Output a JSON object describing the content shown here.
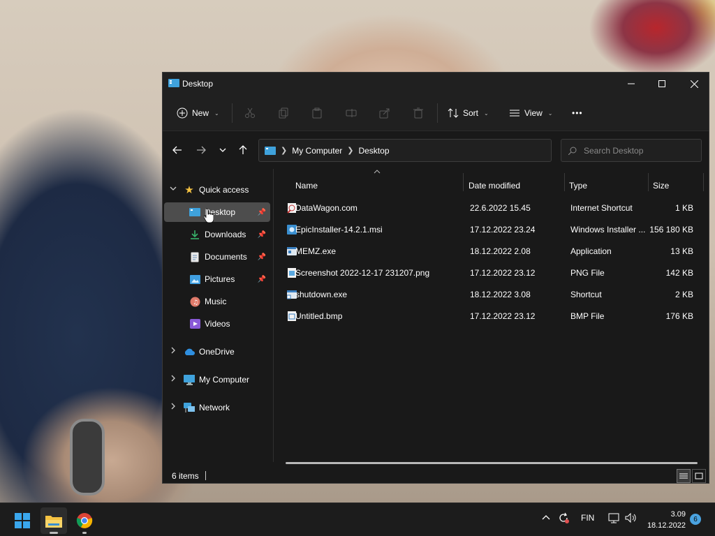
{
  "window": {
    "title": "Desktop"
  },
  "toolbar": {
    "new_label": "New",
    "sort_label": "Sort",
    "view_label": "View",
    "more_label": "•••"
  },
  "address": {
    "crumbs": [
      "My Computer",
      "Desktop"
    ],
    "search_placeholder": "Search Desktop"
  },
  "sidebar": {
    "quick_access": "Quick access",
    "items": [
      {
        "label": "Desktop",
        "icon": "desktop-icon",
        "pinned": true
      },
      {
        "label": "Downloads",
        "icon": "download-icon",
        "pinned": true
      },
      {
        "label": "Documents",
        "icon": "document-icon",
        "pinned": true
      },
      {
        "label": "Pictures",
        "icon": "pictures-icon",
        "pinned": true
      },
      {
        "label": "Music",
        "icon": "music-icon",
        "pinned": false
      },
      {
        "label": "Videos",
        "icon": "video-icon",
        "pinned": false
      }
    ],
    "onedrive": "OneDrive",
    "my_computer": "My Computer",
    "network": "Network"
  },
  "files": {
    "headers": [
      "Name",
      "Date modified",
      "Type",
      "Size"
    ],
    "rows": [
      {
        "name": "DataWagon.com",
        "date": "22.6.2022 15.45",
        "type": "Internet Shortcut",
        "size": "1 KB"
      },
      {
        "name": "EpicInstaller-14.2.1.msi",
        "date": "17.12.2022 23.24",
        "type": "Windows Installer ...",
        "size": "156 180 KB"
      },
      {
        "name": "MEMZ.exe",
        "date": "18.12.2022 2.08",
        "type": "Application",
        "size": "13 KB"
      },
      {
        "name": "Screenshot 2022-12-17 231207.png",
        "date": "17.12.2022 23.12",
        "type": "PNG File",
        "size": "142 KB"
      },
      {
        "name": "shutdown.exe",
        "date": "18.12.2022 3.08",
        "type": "Shortcut",
        "size": "2 KB"
      },
      {
        "name": "Untitled.bmp",
        "date": "17.12.2022 23.12",
        "type": "BMP File",
        "size": "176 KB"
      }
    ]
  },
  "status": {
    "item_count": "6 items"
  },
  "taskbar": {
    "language": "FIN",
    "time": "3.09",
    "date": "18.12.2022",
    "notifications": "6"
  },
  "colors": {
    "window_bg": "#191919",
    "chrome_bg": "#202020",
    "selection": "#4d4d4d",
    "accent": "#4aa3e0",
    "folder_yellow": "#f6c342"
  }
}
